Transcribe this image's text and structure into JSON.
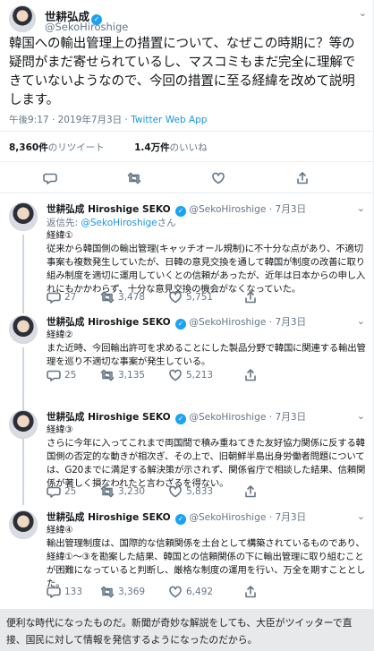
{
  "main_tweet": {
    "name": "世耕弘成",
    "handle": "@SekoHiroshige",
    "text": "韓国への輸出管理上の措置について、なぜこの時期に？等の疑問がまだ寄せられているし、マスコミもまだ完全に理解できていないようなので、今回の措置に至る経緯を改めて説明します。",
    "time": "午後9:17 · 2019年7月3日 · ",
    "source": "Twitter Web App",
    "retweets_count": "8,360件",
    "retweets_label": "のリツイート",
    "likes_count": "1.4万件",
    "likes_label": "のいいね"
  },
  "replies": [
    {
      "name": "世耕弘成 Hiroshige SEKO",
      "handle": "@SekoHiroshige",
      "date": "· 7月3日",
      "reply_to_label": "返信先: ",
      "reply_to_handle": "@SekoHiroshige",
      "reply_to_suffix": "さん",
      "title": "経緯①",
      "body": "従来から韓国側の輸出管理(キャッチオール規制)に不十分な点があり、不適切事案も複数発生していたが、日韓の意見交換を通して韓国が制度の改善に取り組み制度を適切に運用していくとの信頼があったが、近年は日本からの申し入れにもかかわらず、十分な意見交換の機会がなくなっていた。",
      "replies": "27",
      "retweets": "3,478",
      "likes": "5,751"
    },
    {
      "name": "世耕弘成 Hiroshige SEKO",
      "handle": "@SekoHiroshige",
      "date": "· 7月3日",
      "title": "経緯②",
      "body": "また近時、今回輸出許可を求めることにした製品分野で韓国に関連する輸出管理を巡り不適切な事案が発生している。",
      "replies": "25",
      "retweets": "3,135",
      "likes": "5,213"
    },
    {
      "name": "世耕弘成 Hiroshige SEKO",
      "handle": "@SekoHiroshige",
      "date": "· 7月3日",
      "title": "経緯③",
      "body": "さらに今年に入ってこれまで両国間で積み重ねてきた友好協力関係に反する韓国側の否定的な動きが相次ぎ、その上で、旧朝鮮半島出身労働者問題については、G20までに満足する解決策が示されず、関係省庁で相談した結果、信頼関係が著しく損なわれたと言わざるを得ない。",
      "replies": "25",
      "retweets": "3,230",
      "likes": "5,833"
    },
    {
      "name": "世耕弘成 Hiroshige SEKO",
      "handle": "@SekoHiroshige",
      "date": "· 7月3日",
      "title": "経緯④",
      "body": "輸出管理制度は、国際的な信頼関係を土台として構築されているものであり、経緯①〜③を勘案した結果、韓国との信頼関係の下に輸出管理に取り組むことが困難になっていると判断し、厳格な制度の運用を行い、万全を期すこととした。",
      "replies": "133",
      "retweets": "3,369",
      "likes": "6,492"
    }
  ],
  "icons": {
    "reply": "speech-bubble-icon",
    "retweet": "retweet-arrows-icon",
    "like": "heart-icon",
    "share": "share-upload-icon",
    "verified": "verified-badge-icon",
    "more": "chevron-down-icon"
  },
  "footer_note": "便利な時代になったものだ。新聞が奇妙な解説をしても、大臣がツイッターで直接、国民に対して情報を発信するようになったのだから。",
  "colors": {
    "twitter_blue": "#1da1f2",
    "text_secondary": "#657786",
    "divider": "#e6ecf0"
  }
}
